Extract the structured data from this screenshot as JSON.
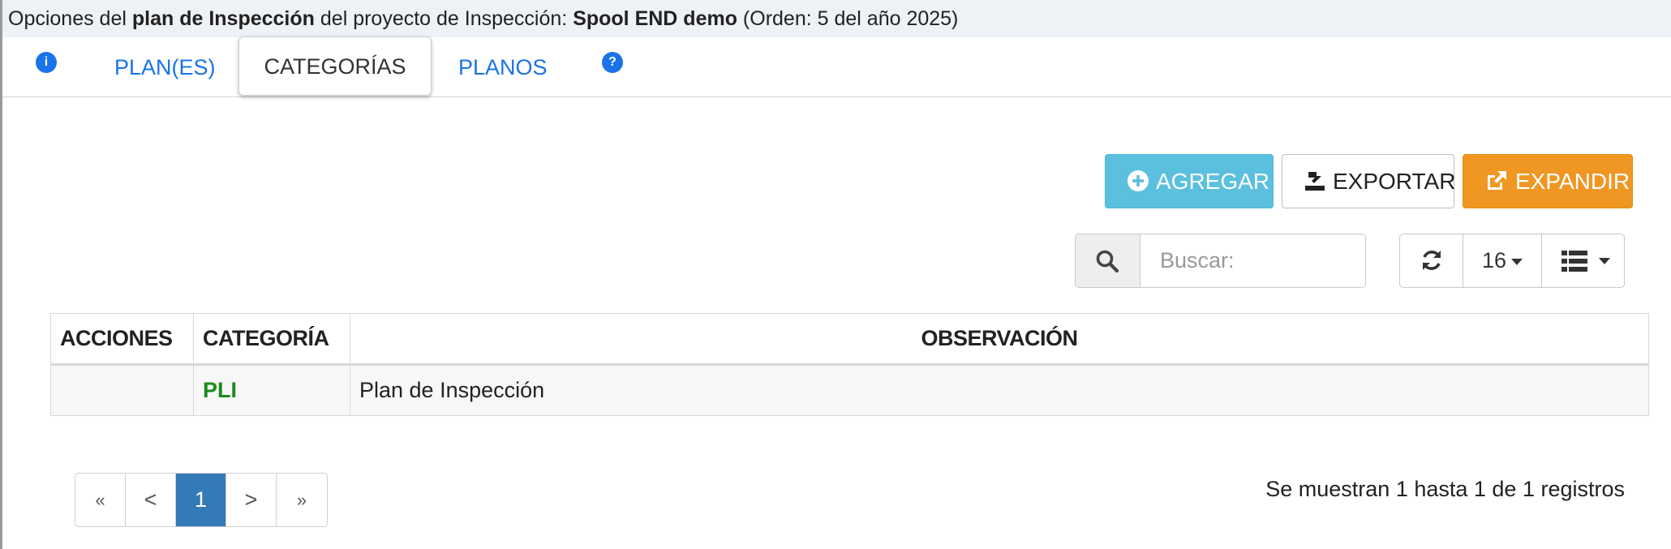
{
  "header": {
    "prefix": "Opciones del ",
    "bold1": "plan de Inspección",
    "middle": " del proyecto de Inspección: ",
    "bold2": "Spool END demo",
    "suffix": " (Orden: 5 del año 2025)"
  },
  "tabs": {
    "info_icon": "i",
    "plans": "PLAN(ES)",
    "categories": "CATEGORÍAS",
    "drawings": "PLANOS",
    "help_icon": "?"
  },
  "toolbar": {
    "add_label": "AGREGAR",
    "export_label": "EXPORTAR",
    "expand_label": "EXPANDIR"
  },
  "search": {
    "placeholder": "Buscar:",
    "value": ""
  },
  "table_tools": {
    "page_size": "16"
  },
  "table": {
    "headers": [
      "ACCIONES",
      "CATEGORÍA",
      "OBSERVACIÓN"
    ],
    "rows": [
      {
        "actions": "",
        "category": "PLI",
        "observation": "Plan de Inspección"
      }
    ]
  },
  "pagination": {
    "first": "«",
    "prev": "<",
    "current": "1",
    "next": ">",
    "last": "»"
  },
  "footer": {
    "records": "Se muestran 1 hasta 1 de 1 registros"
  },
  "colors": {
    "accent": "#1a73e8",
    "add": "#5bc0de",
    "expand": "#ef9722",
    "active_page": "#337ab7",
    "category_text": "#1c8a1c"
  }
}
